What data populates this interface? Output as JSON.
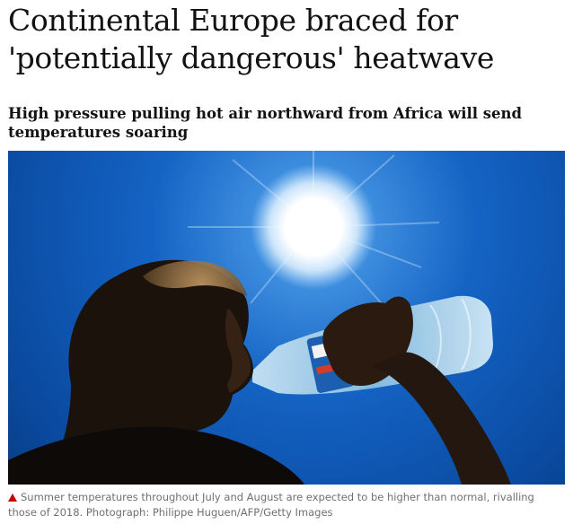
{
  "article": {
    "headline": "Continental Europe braced for 'potentially dangerous' heatwave",
    "standfirst": "High pressure pulling hot air northward from Africa will send temperatures soaring"
  },
  "image": {
    "caption": "Summer temperatures throughout July and August are expected to be higher than normal, rivalling those of 2018. Photograph: Philippe Huguen/AFP/Getty Images"
  },
  "icons": {
    "caption_marker": "red-triangle-icon"
  },
  "colors": {
    "caption_marker": "#c70000",
    "caption_text": "#707070",
    "headline_text": "#121212",
    "sky": "#0a3f8a"
  }
}
